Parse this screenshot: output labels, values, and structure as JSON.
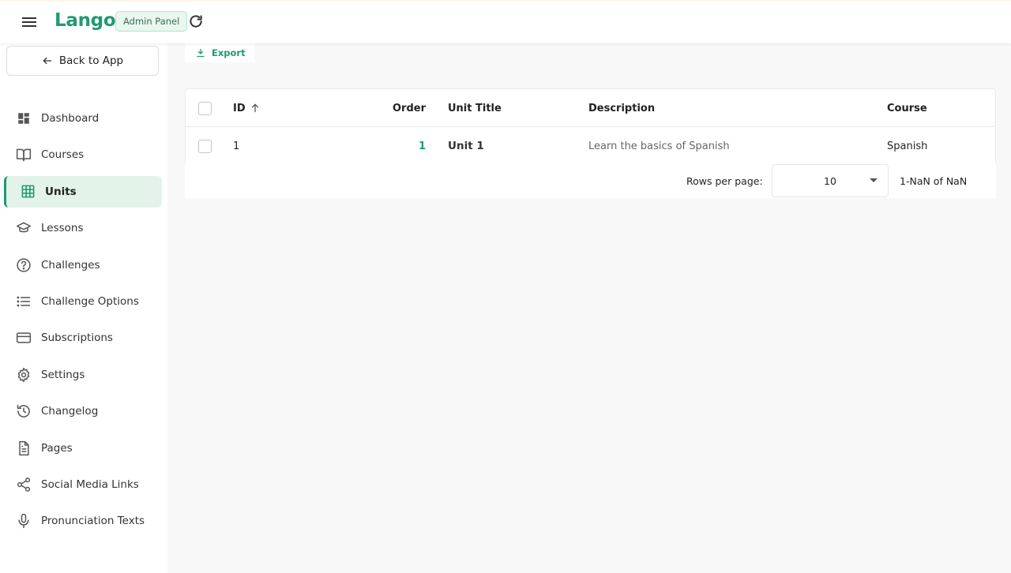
{
  "app": {
    "logo": "Lango",
    "badge": "Admin Panel"
  },
  "sidebar": {
    "back_label": "Back to App",
    "items": [
      {
        "label": "Dashboard",
        "icon": "dashboard-icon",
        "active": false
      },
      {
        "label": "Courses",
        "icon": "book-icon",
        "active": false
      },
      {
        "label": "Units",
        "icon": "grid-icon",
        "active": true
      },
      {
        "label": "Lessons",
        "icon": "graduation-cap-icon",
        "active": false
      },
      {
        "label": "Challenges",
        "icon": "help-circle-icon",
        "active": false
      },
      {
        "label": "Challenge Options",
        "icon": "list-icon",
        "active": false
      },
      {
        "label": "Subscriptions",
        "icon": "credit-card-icon",
        "active": false
      },
      {
        "label": "Settings",
        "icon": "gear-icon",
        "active": false
      },
      {
        "label": "Changelog",
        "icon": "history-icon",
        "active": false
      },
      {
        "label": "Pages",
        "icon": "file-text-icon",
        "active": false
      },
      {
        "label": "Social Media Links",
        "icon": "share-icon",
        "active": false
      },
      {
        "label": "Pronunciation Texts",
        "icon": "mic-icon",
        "active": false
      }
    ]
  },
  "toolbar": {
    "export_label": "Export"
  },
  "table": {
    "columns": {
      "id": "ID",
      "order": "Order",
      "title": "Unit Title",
      "description": "Description",
      "course": "Course"
    },
    "rows": [
      {
        "id": "1",
        "order": "1",
        "title": "Unit 1",
        "description": "Learn the basics of Spanish",
        "course": "Spanish"
      }
    ]
  },
  "pagination": {
    "rows_label": "Rows per page:",
    "rows_value": "10",
    "range": "1-NaN of NaN"
  },
  "colors": {
    "accent": "#1f9a6f",
    "active_bg": "#e3f3ea"
  }
}
